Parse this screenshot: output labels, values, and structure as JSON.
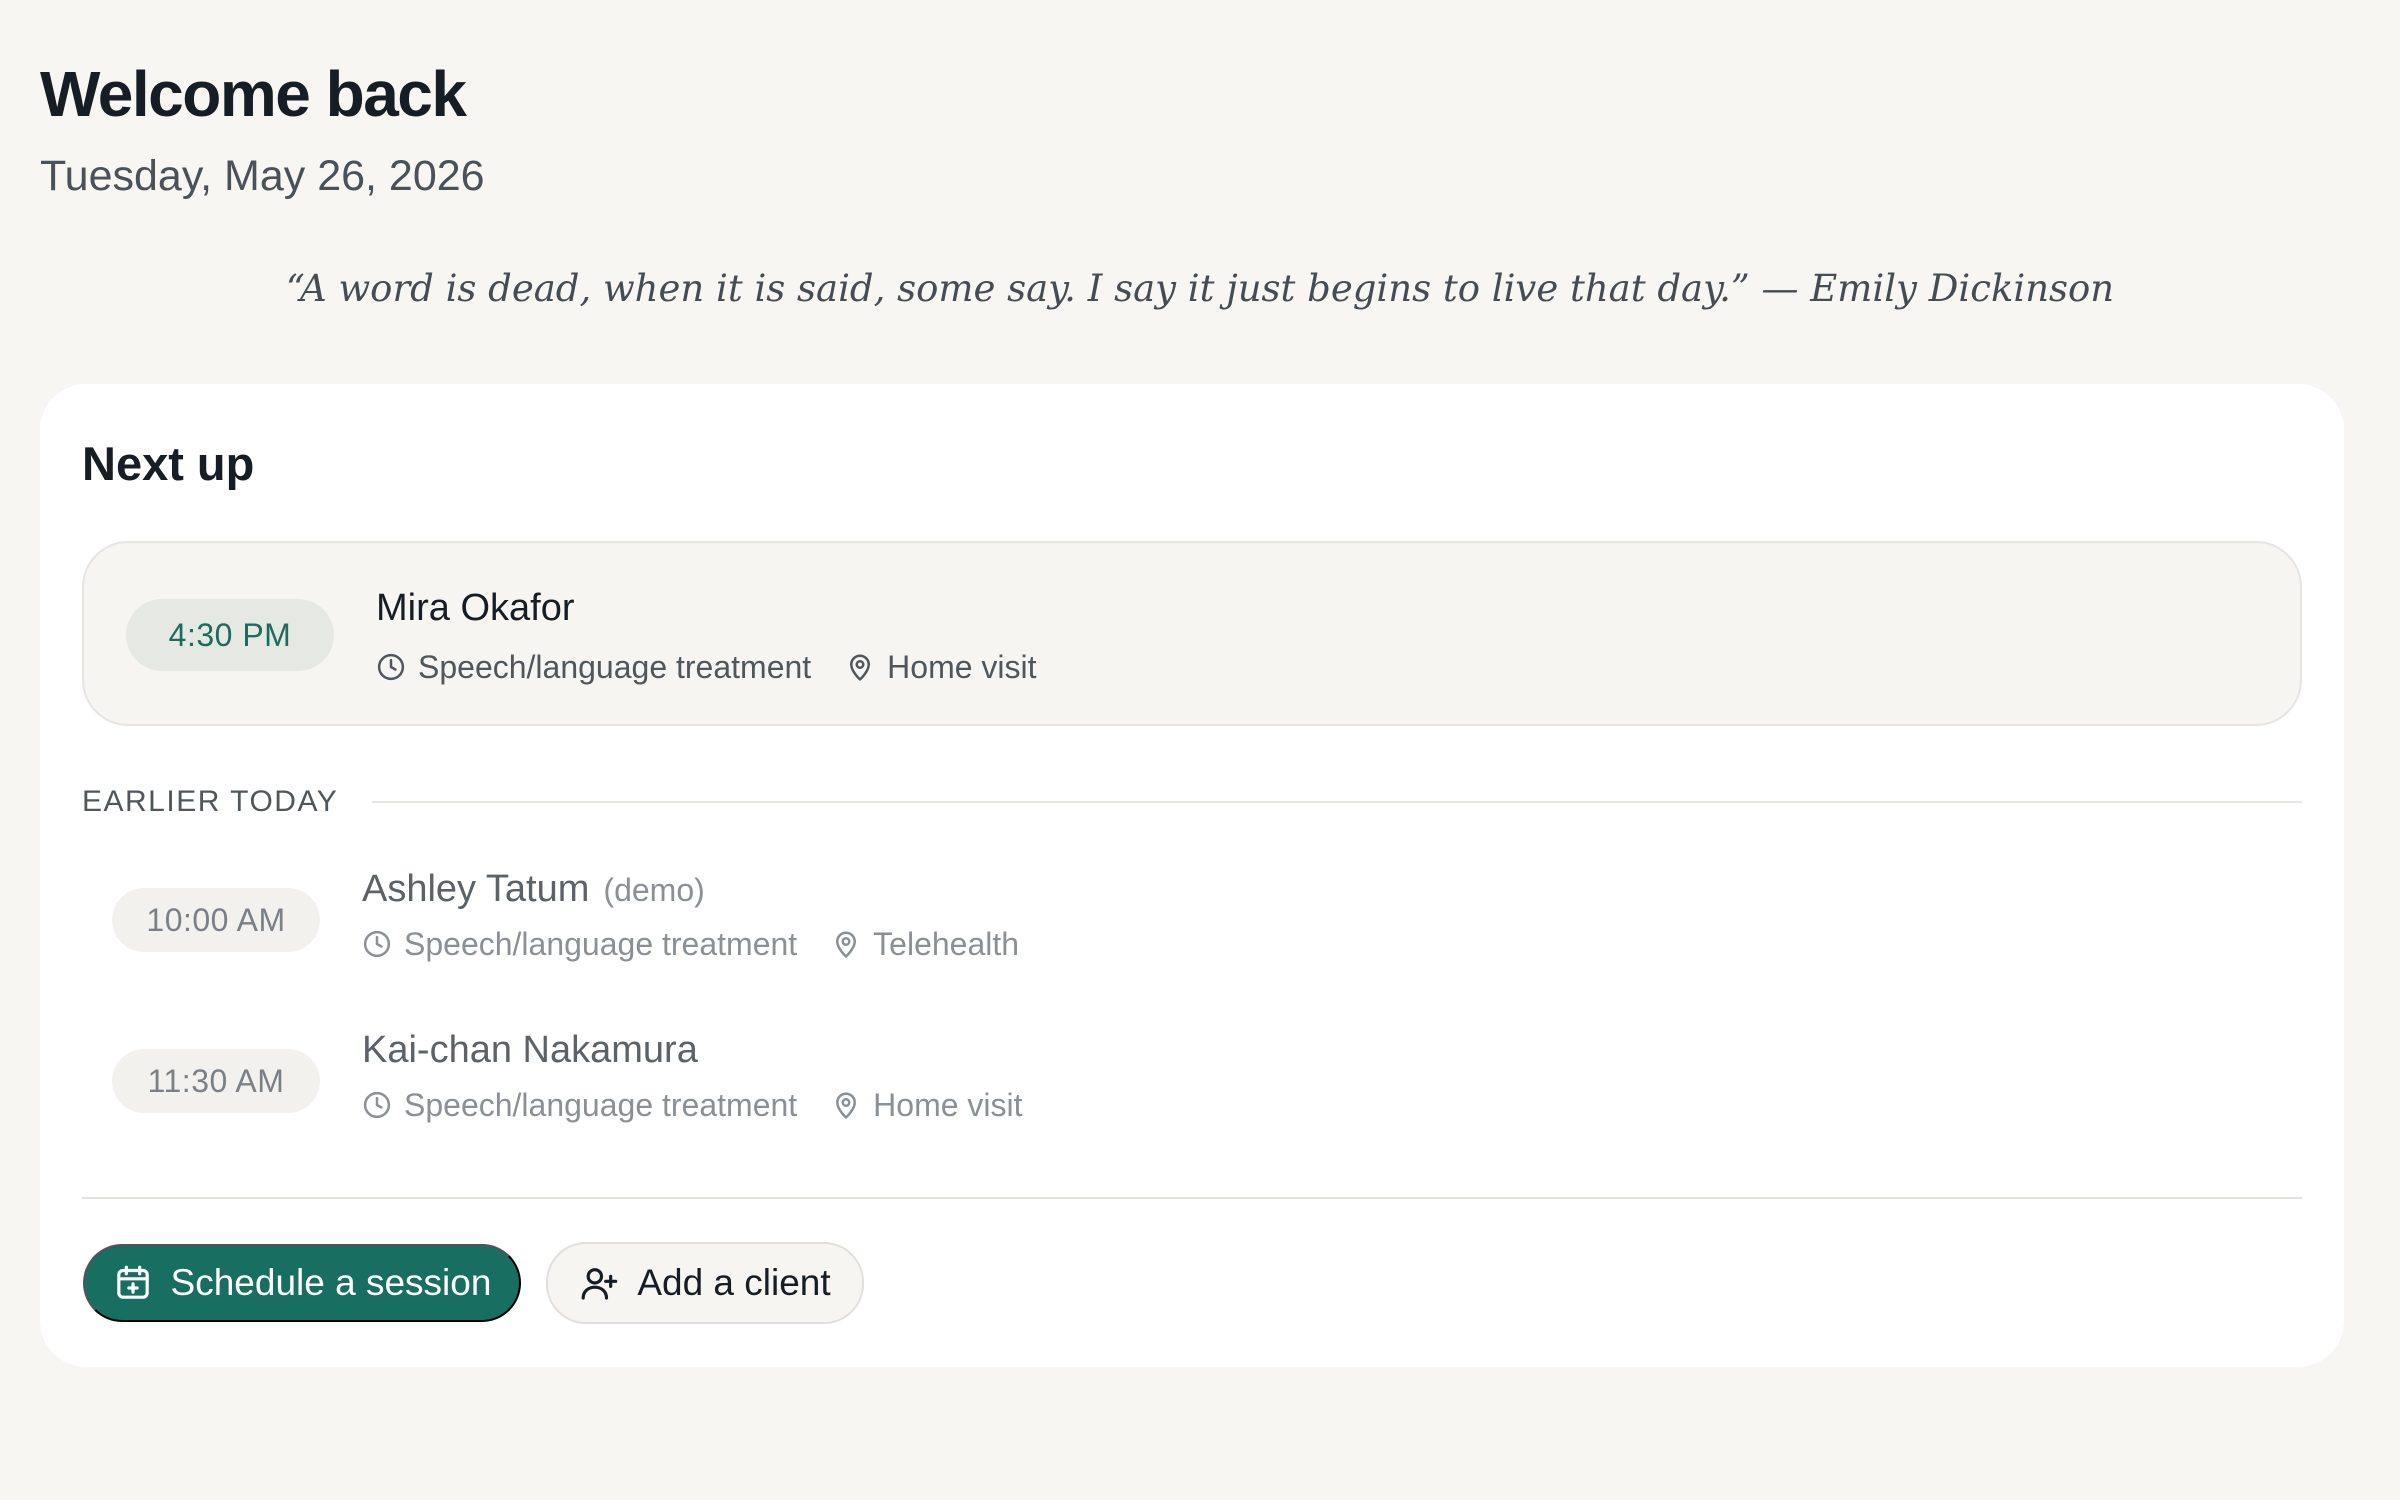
{
  "header": {
    "title": "Welcome back",
    "date": "Tuesday, May 26, 2026",
    "quote": "“A word is dead, when it is said, some say. I say it just begins to live that day.” — Emily Dickinson"
  },
  "card": {
    "title": "Next up",
    "next_appointment": {
      "time": "4:30 PM",
      "client": "Mira Okafor",
      "service": "Speech/language treatment",
      "location": "Home visit",
      "time_icon": "clock-icon",
      "location_icon": "map-pin-icon"
    },
    "earlier_label": "EARLIER TODAY",
    "earlier": [
      {
        "time": "10:00 AM",
        "client": "Ashley Tatum",
        "tag": "(demo)",
        "service": "Speech/language treatment",
        "location": "Telehealth"
      },
      {
        "time": "11:30 AM",
        "client": "Kai-chan Nakamura",
        "service": "Speech/language treatment",
        "location": "Home visit"
      }
    ],
    "actions": {
      "schedule_label": "Schedule a session",
      "schedule_icon": "calendar-plus-icon",
      "add_client_label": "Add a client",
      "add_client_icon": "user-plus-icon"
    }
  },
  "colors": {
    "background": "#f7f6f3",
    "card": "#ffffff",
    "accent": "#176e61",
    "accent_text": "#1d6b5f"
  }
}
